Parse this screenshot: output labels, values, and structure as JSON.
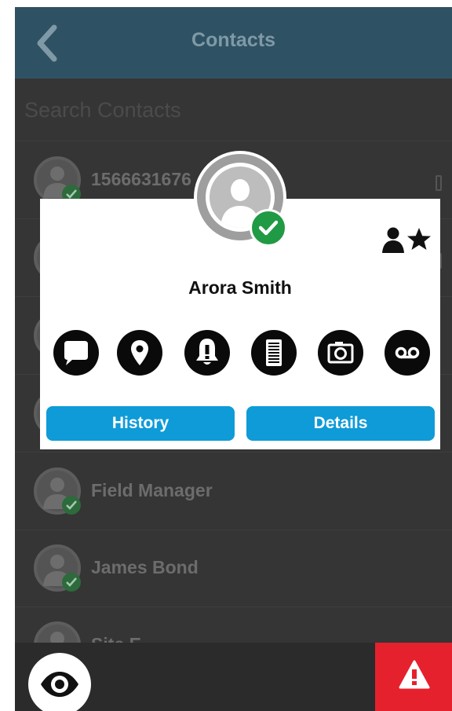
{
  "header": {
    "title": "Contacts",
    "back_icon": "chevron-left-icon"
  },
  "search": {
    "placeholder": "Search Contacts",
    "value": ""
  },
  "contacts": [
    {
      "name": "1566631676",
      "status": "online",
      "device_icon": "walkie-talkie-icon"
    },
    {
      "name": "",
      "status": "online",
      "device_icon": "walkie-talkie-icon"
    },
    {
      "name": "",
      "status": "online"
    },
    {
      "name": "",
      "status": "online"
    },
    {
      "name": "Field Manager",
      "status": "online"
    },
    {
      "name": "James Bond",
      "status": "online"
    },
    {
      "name": "Site E",
      "status": "online"
    }
  ],
  "dialog": {
    "name": "Arora Smith",
    "status": "online",
    "badges": [
      "person-icon",
      "star-icon"
    ],
    "actions": [
      "message-icon",
      "location-pin-icon",
      "alert-bell-icon",
      "document-icon",
      "camera-icon",
      "voicemail-icon"
    ],
    "history_label": "History",
    "details_label": "Details"
  },
  "bottom_bar": {
    "left_icon": "eye-icon",
    "right_icon": "warning-icon"
  },
  "colors": {
    "header_bg": "#2e5263",
    "background": "#353535",
    "accent_button": "#0e9bd8",
    "online_green": "#209a44",
    "alert_red": "#e5212d"
  }
}
